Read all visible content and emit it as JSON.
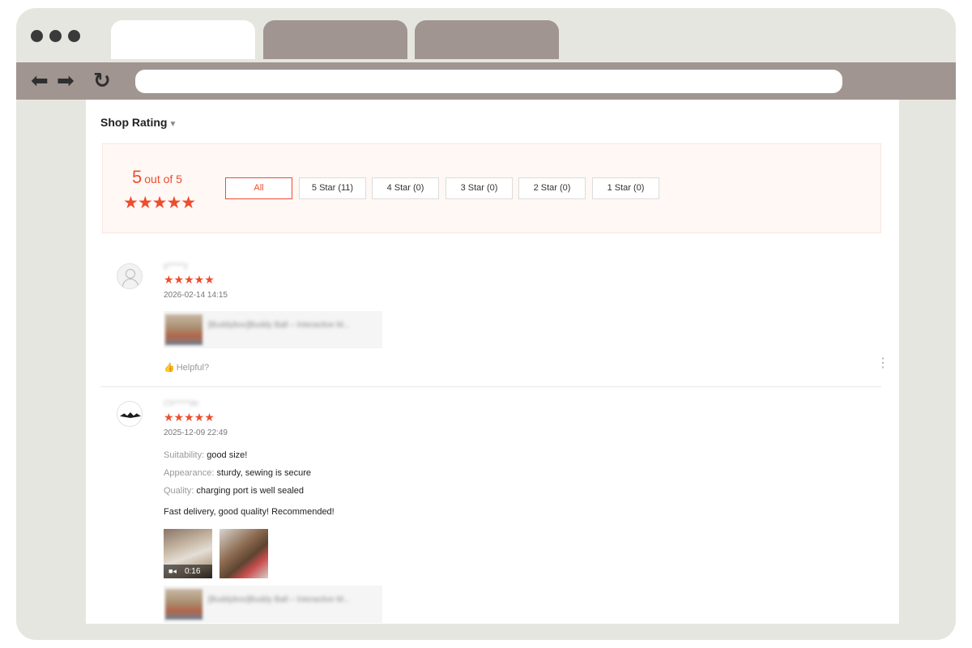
{
  "browser": {
    "tabs": [
      "",
      "",
      ""
    ],
    "address": ""
  },
  "page": {
    "section_title": "Shop Rating",
    "summary": {
      "score": "5",
      "score_suffix": "out of 5",
      "stars": "★★★★★"
    },
    "filters": [
      {
        "label": "All",
        "active": true
      },
      {
        "label": "5 Star (11)",
        "active": false
      },
      {
        "label": "4 Star (0)",
        "active": false
      },
      {
        "label": "3 Star (0)",
        "active": false
      },
      {
        "label": "2 Star (0)",
        "active": false
      },
      {
        "label": "1 Star (0)",
        "active": false
      }
    ],
    "reviews": [
      {
        "username": "p*****y",
        "stars": "★★★★★",
        "date": "2026-02-14 14:15",
        "product": "[Buddyboo]Buddy Ball – Interactive M...",
        "helpful": "Helpful?"
      },
      {
        "username": "Ch*****de",
        "stars": "★★★★★",
        "date": "2025-12-09 22:49",
        "attributes": [
          {
            "key": "Suitability:",
            "value": "good size!"
          },
          {
            "key": "Appearance:",
            "value": "sturdy, sewing is secure"
          },
          {
            "key": "Quality:",
            "value": "charging port is well sealed"
          }
        ],
        "text": "Fast delivery, good quality! Recommended!",
        "video_duration": "0:16",
        "product": "[Buddyboo]Buddy Ball – Interactive M..."
      }
    ]
  },
  "colors": {
    "accent": "#ee4d2d",
    "summary_bg": "#fff8f5",
    "browser_chrome": "#a09590"
  }
}
